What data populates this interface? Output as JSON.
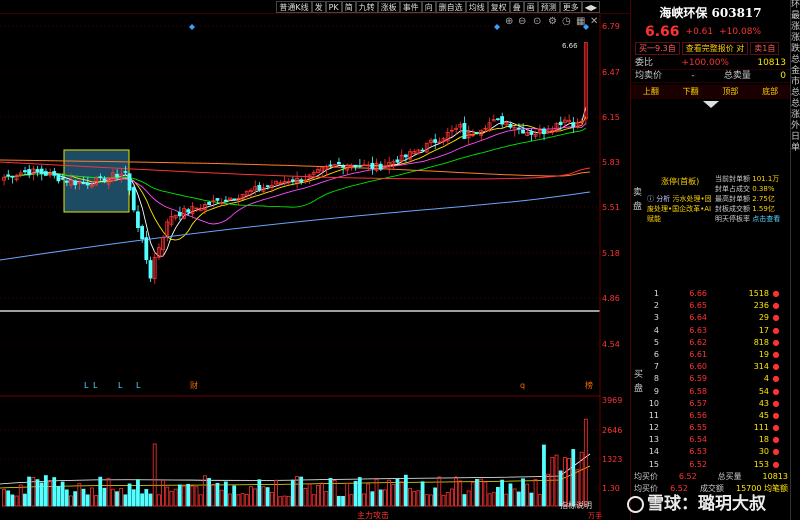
{
  "toolbar": {
    "items": [
      "普通K线",
      "发",
      "PK",
      "简",
      "九转",
      "涨板",
      "事件",
      "向",
      "删自选",
      "均线",
      "复权",
      "叠",
      "画",
      "预测",
      "更多"
    ],
    "arrows": "◀▶"
  },
  "stock": {
    "name": "海峡环保 603817",
    "price": "6.66",
    "change": "+0.61",
    "pct": "+10.08%"
  },
  "buttons": {
    "buy_label": "买一9.3自",
    "view_label": "查看完整报价 对",
    "sell_label": "卖1自"
  },
  "ratio": {
    "label": "委比",
    "value": "+100.00%",
    "right_value": "10813"
  },
  "avg": {
    "label": "均卖价",
    "sep": "-",
    "total_label": "总卖量",
    "total_value": "0"
  },
  "nav": [
    "上翻",
    "下翻",
    "顶部",
    "底部"
  ],
  "limit": {
    "side_label": "卖盘",
    "badge": "涨停(首板)",
    "analysis_label": "分析",
    "analysis_text": "污水处理•固废处理•国企改革•AI赋能",
    "stats": [
      {
        "k": "当前封单额",
        "v": "101.1万"
      },
      {
        "k": "封单占成交",
        "v": "0.38%"
      },
      {
        "k": "最高封单额",
        "v": "2.75亿"
      },
      {
        "k": "封板成交额",
        "v": "1.59亿"
      },
      {
        "k": "明天停板率",
        "v": "点击查看"
      }
    ]
  },
  "orderbook": {
    "side_label": "买盘",
    "rows": [
      {
        "i": "1",
        "p": "6.66",
        "v": "1518"
      },
      {
        "i": "2",
        "p": "6.65",
        "v": "236"
      },
      {
        "i": "3",
        "p": "6.64",
        "v": "29"
      },
      {
        "i": "4",
        "p": "6.63",
        "v": "17"
      },
      {
        "i": "5",
        "p": "6.62",
        "v": "818"
      },
      {
        "i": "6",
        "p": "6.61",
        "v": "19"
      },
      {
        "i": "7",
        "p": "6.60",
        "v": "314"
      },
      {
        "i": "8",
        "p": "6.59",
        "v": "4"
      },
      {
        "i": "9",
        "p": "6.58",
        "v": "54"
      },
      {
        "i": "10",
        "p": "6.57",
        "v": "43"
      },
      {
        "i": "11",
        "p": "6.56",
        "v": "45"
      },
      {
        "i": "12",
        "p": "6.55",
        "v": "111"
      },
      {
        "i": "13",
        "p": "6.54",
        "v": "18"
      },
      {
        "i": "14",
        "p": "6.53",
        "v": "30"
      },
      {
        "i": "15",
        "p": "6.52",
        "v": "153"
      }
    ],
    "bottom": [
      {
        "k": "均买价",
        "v": "6.52",
        "t": "总买量",
        "n": "10813"
      },
      {
        "k": "均买价",
        "v": "6.52",
        "t": "成交额",
        "n": "15700 均笔额"
      }
    ]
  },
  "axis": {
    "price_ticks": [
      "6.79",
      "6.47",
      "6.15",
      "5.83",
      "5.51",
      "5.18",
      "4.86",
      "4.54"
    ],
    "volume_ticks": [
      "3969",
      "2646",
      "1323",
      "1.30"
    ],
    "max_label": "6.66",
    "events": [
      "L",
      "L",
      "L",
      "L",
      "财",
      "q",
      "榜"
    ]
  },
  "labels": {
    "bottom_center": "主力攻击",
    "bottom_right": "指标说明",
    "unit_right": "万手"
  },
  "far_right": "环最涨涨跌总金市总总涨外日单",
  "watermark": "雪球：璐玥大叔",
  "colors": {
    "up": "#ff3232",
    "down": "#54ffff",
    "ma5": "#ffffff",
    "ma10": "#ffe600",
    "ma20": "#ff4cff",
    "ma60": "#00e600",
    "ma120": "#ff7f27",
    "ma250": "#6aa6ff"
  }
}
